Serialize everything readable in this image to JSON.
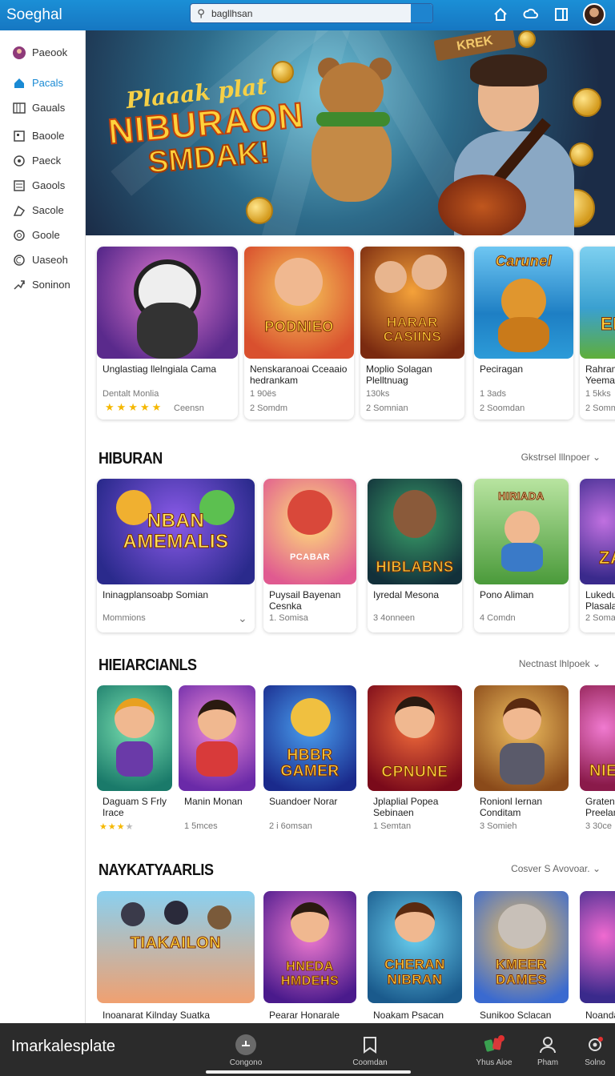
{
  "app": {
    "title": "Soeghal"
  },
  "search": {
    "value": "bagllhsan"
  },
  "sidebar": {
    "items": [
      {
        "label": "Paeook",
        "icon": "profile-icon"
      },
      {
        "label": "Pacals",
        "icon": "home-icon"
      },
      {
        "label": "Gauals",
        "icon": "grid-icon"
      },
      {
        "label": "Baoole",
        "icon": "square-icon"
      },
      {
        "label": "Paeck",
        "icon": "target-icon"
      },
      {
        "label": "Gaools",
        "icon": "list-icon"
      },
      {
        "label": "Sacole",
        "icon": "shape-icon"
      },
      {
        "label": "Goole",
        "icon": "circle-icon"
      },
      {
        "label": "Uaseoh",
        "icon": "c-icon"
      },
      {
        "label": "Soninon",
        "icon": "share-icon"
      }
    ]
  },
  "hero": {
    "line1": "Plaaak plat",
    "line2": "NIBURAON",
    "line3": "SMDAK!",
    "sign": "KREK"
  },
  "featured": [
    {
      "title": "Unglastiag llelngiala Cama",
      "sub": "Dentalt Monlia",
      "rating": "Ceensn",
      "thumb_text": ""
    },
    {
      "title": "Nenskaranoai Cceaaio hedrankam",
      "sub": "1 90ës",
      "meta": "2 Somdm",
      "thumb_text": "PODNIEO"
    },
    {
      "title": "Moplio Solagan Plelltnuag",
      "sub": "130ks",
      "meta": "2 Somnian",
      "thumb_text": "HARAR CASIINS"
    },
    {
      "title": "Peciragan",
      "sub": "1 3ads",
      "meta": "2 Soomdan",
      "thumb_text": "Carunel"
    },
    {
      "title": "Rahram Yeemae",
      "sub": "1 5kks",
      "meta": "2 Somm",
      "thumb_text": "EL"
    }
  ],
  "sections": [
    {
      "title": "HIBURAN",
      "link": "Gkstrsel lllnpoer",
      "cards": [
        {
          "title": "Ininagplansoabp Somian",
          "sub": "Mommions",
          "thumb_text": "NBAN AMEMALIS"
        },
        {
          "title": "Puysail Bayenan Cesnka",
          "sub": "1. Somisa",
          "thumb_text": "PCABAR"
        },
        {
          "title": "Iyredal Mesona",
          "sub": "3 4onneen",
          "thumb_text": "HIBLABNS"
        },
        {
          "title": "Pono Aliman",
          "sub": "4 Comdn",
          "thumb_text": "HIRIADA"
        },
        {
          "title": "Lukedu Plasala",
          "sub": "2 Soma",
          "thumb_text": "ZAL"
        }
      ]
    },
    {
      "title": "HIEIARCIANLS",
      "link": "Nectnast lhlpoek",
      "cards": [
        {
          "title": "Daguam S Frly Irace",
          "sub": "",
          "thumb_text": ""
        },
        {
          "title": "Manin Monan",
          "sub": "1 5mces",
          "thumb_text": ""
        },
        {
          "title": "Suandoer Norar",
          "sub": "2 i 6omsan",
          "thumb_text": "HBBR GAMER"
        },
        {
          "title": "Jplaplial Popea Sebinaen",
          "sub": "1 Semtan",
          "thumb_text": "CPNUNE"
        },
        {
          "title": "Ronionl Iernan Conditam",
          "sub": "3 Somieh",
          "thumb_text": ""
        },
        {
          "title": "Gratenn Preelan",
          "sub": "3 30ce",
          "thumb_text": "NIE"
        }
      ]
    },
    {
      "title": "NAYKATYAARLIS",
      "link": "Cosver S Avovoar.",
      "cards": [
        {
          "title": "Inoanarat Kilnday Suatka",
          "thumb_text": "TIAKAILON"
        },
        {
          "title": "Pearar Honarale",
          "thumb_text": "HNEDA HMDEHS"
        },
        {
          "title": "Noakam Psacan",
          "thumb_text": "CHERAN NIBRAN"
        },
        {
          "title": "Sunikoo Sclacan",
          "thumb_text": "KMEER DAMES"
        },
        {
          "title": "Noandar",
          "thumb_text": ""
        }
      ]
    }
  ],
  "bottombar": {
    "brand": "Imarkalesplate",
    "items": [
      {
        "label": "Congono",
        "icon": "upload-icon"
      },
      {
        "label": "Coomdan",
        "icon": "bookmark-icon"
      },
      {
        "label": "Yhus Aioe",
        "icon": "apps-icon"
      },
      {
        "label": "Pham",
        "icon": "person-icon"
      },
      {
        "label": "Solno",
        "icon": "settings-icon"
      }
    ]
  },
  "colors": {
    "accent": "#1a8ad4",
    "topbar": "#1677c2",
    "star": "#f5b800"
  }
}
